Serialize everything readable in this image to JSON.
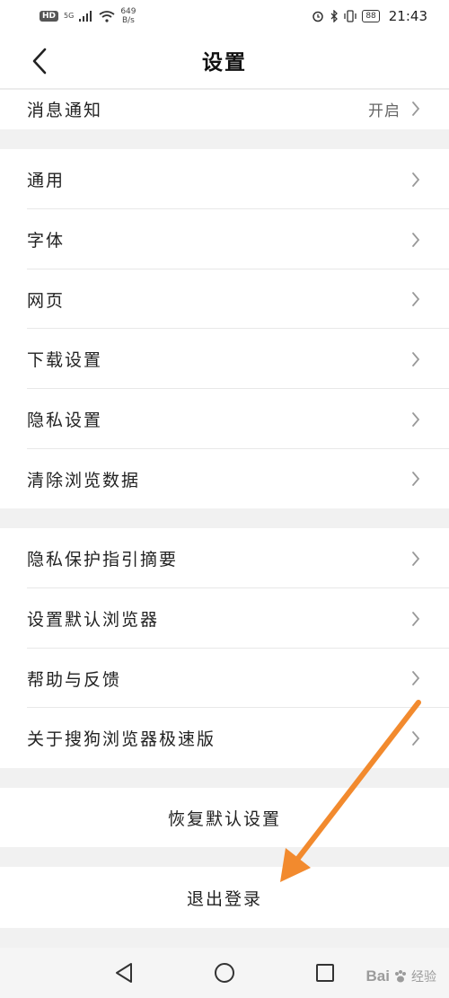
{
  "status_bar": {
    "hd": "HD",
    "network": "5G",
    "speed_value": "649",
    "speed_unit": "B/s",
    "battery": "88",
    "time": "21:43"
  },
  "header": {
    "title": "设置"
  },
  "sections": {
    "notifications": {
      "label": "消息通知",
      "value": "开启"
    },
    "general": {
      "label": "通用"
    },
    "font": {
      "label": "字体"
    },
    "webpage": {
      "label": "网页"
    },
    "download": {
      "label": "下载设置"
    },
    "privacy": {
      "label": "隐私设置"
    },
    "clear_data": {
      "label": "清除浏览数据"
    },
    "privacy_guide": {
      "label": "隐私保护指引摘要"
    },
    "default_browser": {
      "label": "设置默认浏览器"
    },
    "help": {
      "label": "帮助与反馈"
    },
    "about": {
      "label": "关于搜狗浏览器极速版"
    }
  },
  "actions": {
    "restore": "恢复默认设置",
    "logout": "退出登录"
  },
  "watermark": {
    "brand": "Bai",
    "brand_suffix": "经验"
  },
  "colors": {
    "accent_arrow": "#f28a2e",
    "gap_bg": "#f1f1f1"
  }
}
